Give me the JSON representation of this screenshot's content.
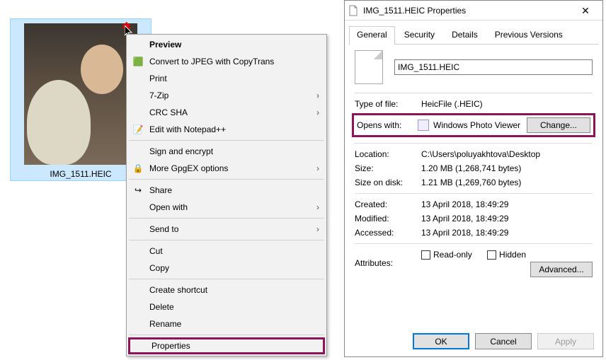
{
  "file": {
    "name": "IMG_1511.HEIC"
  },
  "menu": {
    "preview": "Preview",
    "convert": "Convert to JPEG with CopyTrans",
    "print": "Print",
    "sevenzip": "7-Zip",
    "crcsha": "CRC SHA",
    "notepad": "Edit with Notepad++",
    "sign": "Sign and encrypt",
    "gpg": "More GpgEX options",
    "share": "Share",
    "openwith": "Open with",
    "sendto": "Send to",
    "cut": "Cut",
    "copy": "Copy",
    "shortcut": "Create shortcut",
    "delete": "Delete",
    "rename": "Rename",
    "properties": "Properties"
  },
  "dialog": {
    "title": "IMG_1511.HEIC Properties",
    "tabs": {
      "general": "General",
      "security": "Security",
      "details": "Details",
      "previous": "Previous Versions"
    },
    "filename": "IMG_1511.HEIC",
    "typeoffile_k": "Type of file:",
    "typeoffile_v": "HeicFile (.HEIC)",
    "openswith_k": "Opens with:",
    "openswith_v": "Windows Photo Viewer",
    "change": "Change...",
    "location_k": "Location:",
    "location_v": "C:\\Users\\poluyakhtova\\Desktop",
    "size_k": "Size:",
    "size_v": "1.20 MB (1,268,741 bytes)",
    "sod_k": "Size on disk:",
    "sod_v": "1.21 MB (1,269,760 bytes)",
    "created_k": "Created:",
    "created_v": "13 April 2018, 18:49:29",
    "modified_k": "Modified:",
    "modified_v": "13 April 2018, 18:49:29",
    "accessed_k": "Accessed:",
    "accessed_v": "13 April 2018, 18:49:29",
    "attributes_k": "Attributes:",
    "readonly": "Read-only",
    "hidden": "Hidden",
    "advanced": "Advanced...",
    "ok": "OK",
    "cancel": "Cancel",
    "apply": "Apply"
  }
}
